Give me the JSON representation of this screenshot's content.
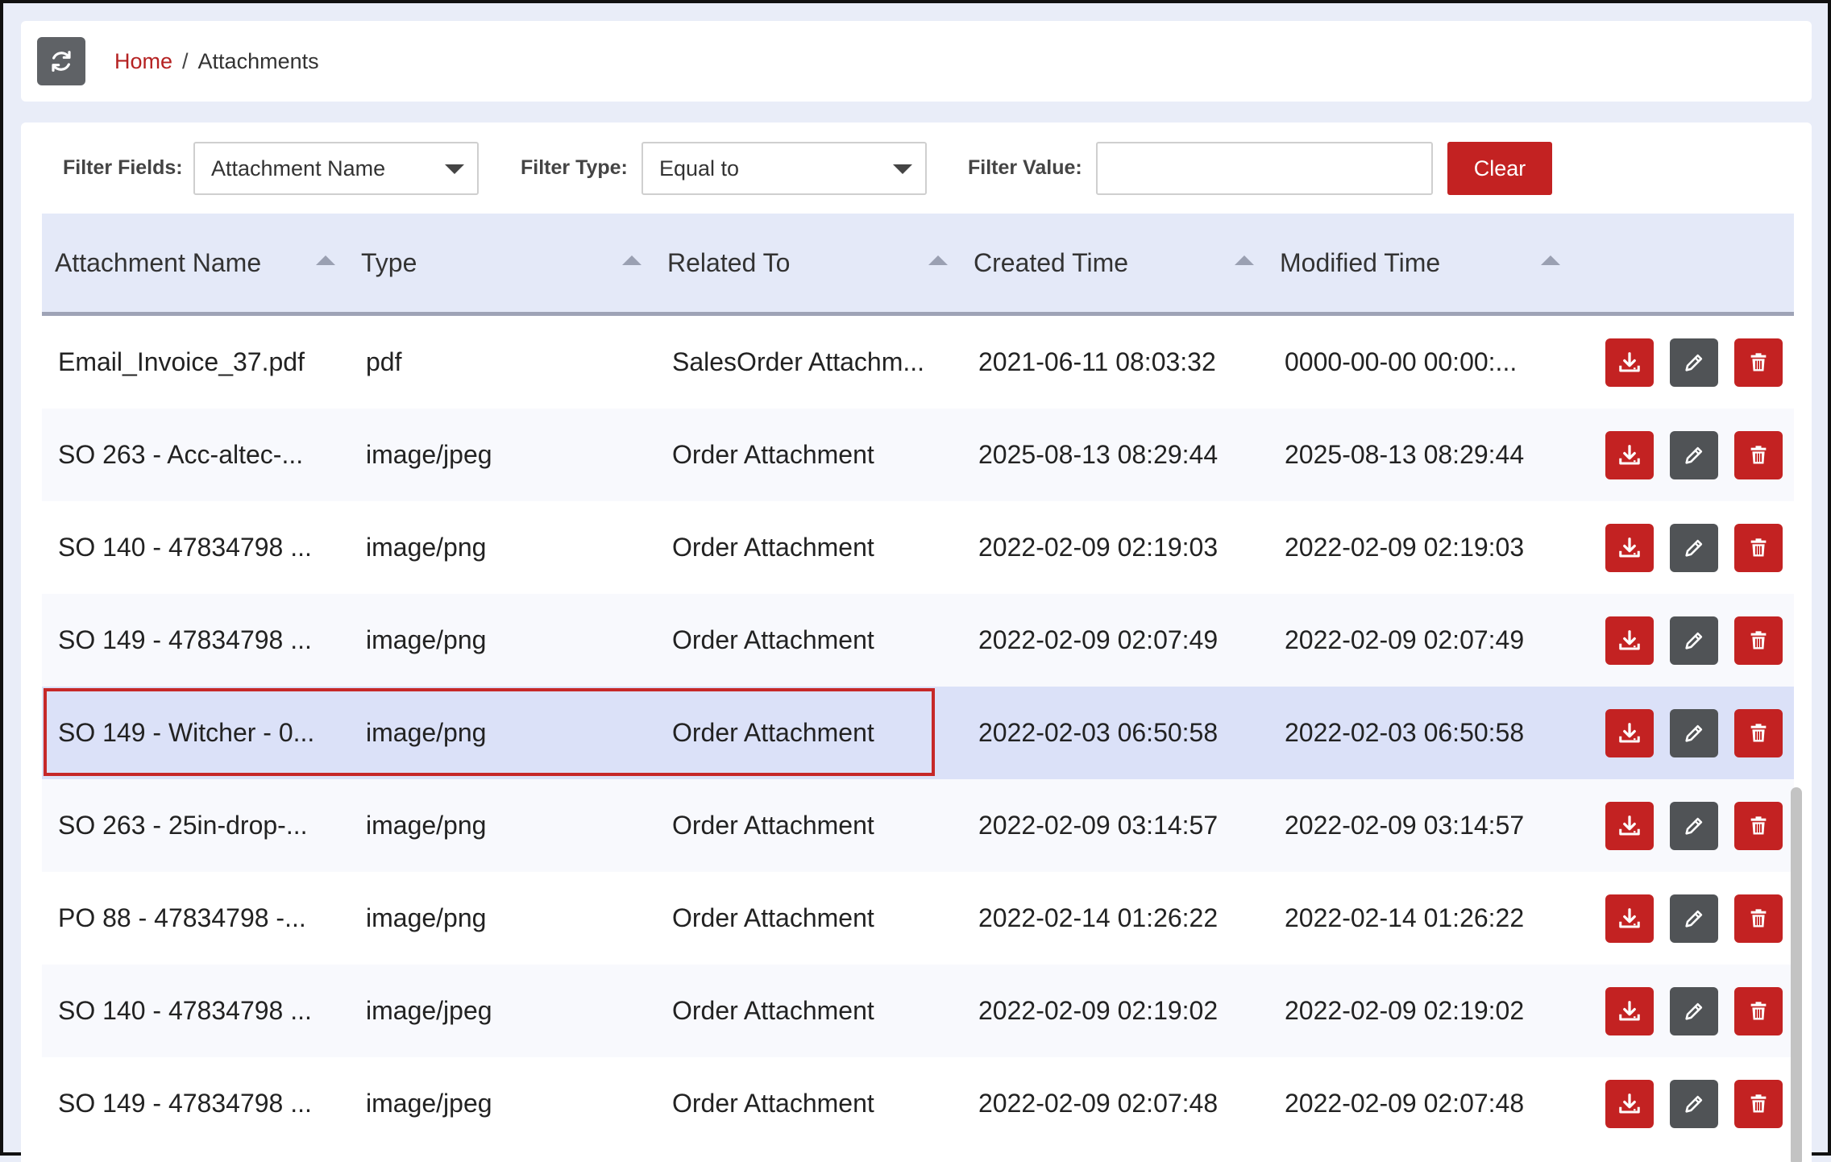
{
  "breadcrumb": {
    "home": "Home",
    "separator": "/",
    "current": "Attachments"
  },
  "filters": {
    "fields_label": "Filter Fields:",
    "fields_value": "Attachment Name",
    "type_label": "Filter Type:",
    "type_value": "Equal to",
    "value_label": "Filter Value:",
    "value_text": "",
    "clear_label": "Clear"
  },
  "table": {
    "headers": [
      "Attachment Name",
      "Type",
      "Related To",
      "Created Time",
      "Modified Time"
    ],
    "rows": [
      {
        "name": "Email_Invoice_37.pdf",
        "type": "pdf",
        "related": "SalesOrder Attachm...",
        "created": "2021-06-11 08:03:32",
        "modified": "0000-00-00 00:00:..."
      },
      {
        "name": "SO 263 - Acc-altec-...",
        "type": "image/jpeg",
        "related": "Order Attachment",
        "created": "2025-08-13 08:29:44",
        "modified": "2025-08-13 08:29:44"
      },
      {
        "name": "SO 140 - 47834798 ...",
        "type": "image/png",
        "related": "Order Attachment",
        "created": "2022-02-09 02:19:03",
        "modified": "2022-02-09 02:19:03"
      },
      {
        "name": "SO 149 - 47834798 ...",
        "type": "image/png",
        "related": "Order Attachment",
        "created": "2022-02-09 02:07:49",
        "modified": "2022-02-09 02:07:49"
      },
      {
        "name": "SO 149 - Witcher - 0...",
        "type": "image/png",
        "related": "Order Attachment",
        "created": "2022-02-03 06:50:58",
        "modified": "2022-02-03 06:50:58"
      },
      {
        "name": "SO 263 - 25in-drop-...",
        "type": "image/png",
        "related": "Order Attachment",
        "created": "2022-02-09 03:14:57",
        "modified": "2022-02-09 03:14:57"
      },
      {
        "name": "PO 88 - 47834798 -...",
        "type": "image/png",
        "related": "Order Attachment",
        "created": "2022-02-14 01:26:22",
        "modified": "2022-02-14 01:26:22"
      },
      {
        "name": "SO 140 - 47834798 ...",
        "type": "image/jpeg",
        "related": "Order Attachment",
        "created": "2022-02-09 02:19:02",
        "modified": "2022-02-09 02:19:02"
      },
      {
        "name": "SO 149 - 47834798 ...",
        "type": "image/jpeg",
        "related": "Order Attachment",
        "created": "2022-02-09 02:07:48",
        "modified": "2022-02-09 02:07:48"
      }
    ],
    "selected_row": 4
  },
  "icons": {
    "refresh": "refresh-icon",
    "download": "download-icon",
    "edit": "pencil-icon",
    "delete": "trash-icon"
  },
  "colors": {
    "accent_red": "#c32222",
    "selected_row": "#dbe1f8",
    "header_bg": "#e4e9f8"
  }
}
